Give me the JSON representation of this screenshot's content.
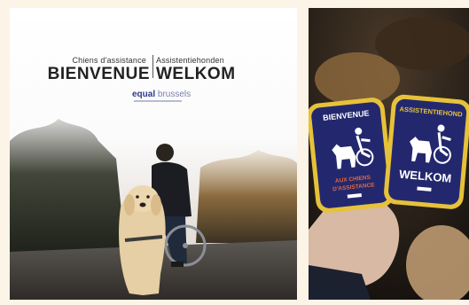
{
  "poster": {
    "subtitle_fr": "Chiens d'assistance",
    "subtitle_nl": "Assistentiehonden",
    "title_fr": "BIENVENUE",
    "title_nl": "WELKOM",
    "brand_main": "equal",
    "brand_city": "brussels",
    "colors": {
      "title": "#222222",
      "brand": "#2d3a8c"
    }
  },
  "stickers": {
    "left": {
      "top_text": "BIENVENUE",
      "bottom_lines": [
        "AUX CHIENS",
        "D'ASSISTANCE"
      ],
      "colors": {
        "frame": "#e6c23a",
        "inner": "#23286e",
        "accent": "#e2653b"
      }
    },
    "right": {
      "top_text": "ASSISTENTIEHOND",
      "bottom_text": "WELKOM",
      "colors": {
        "frame": "#e6c23a",
        "inner": "#23286e"
      }
    }
  }
}
